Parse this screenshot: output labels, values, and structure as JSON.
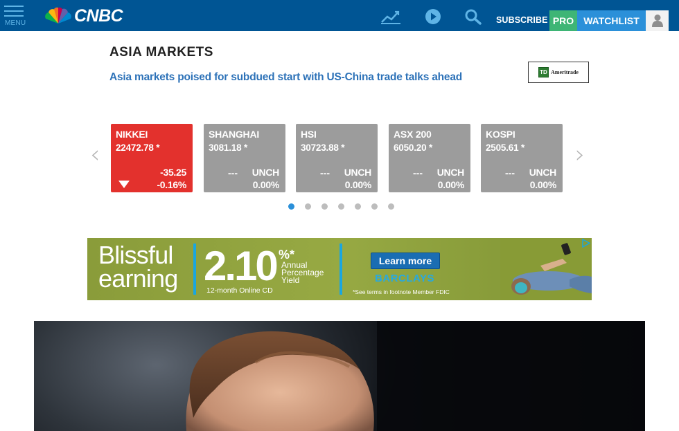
{
  "header": {
    "menu_label": "MENU",
    "brand": "CNBC",
    "subscribe_label": "SUBSCRIBE ›",
    "pro_label": "PRO",
    "watchlist_label": "WATCHLIST",
    "icons": [
      "menu-icon",
      "cnbc-peacock-logo",
      "chart-icon",
      "play-icon",
      "search-icon",
      "user-icon"
    ],
    "colors": {
      "bar": "#005594",
      "pro": "#3eb575",
      "watchlist": "#2b90d9"
    }
  },
  "markets": {
    "section_title": "ASIA MARKETS",
    "headline": "Asia markets poised for subdued start with US-China trade talks ahead",
    "sponsor": {
      "logo_mark": "TD",
      "name": "Ameritrade"
    },
    "cards": [
      {
        "name": "NIKKEI",
        "value": "22472.78 *",
        "change": "-35.25",
        "pct": "-0.16%",
        "state": "down",
        "color": "#e3312d"
      },
      {
        "name": "SHANGHAI",
        "value": "3081.18 *",
        "change": "UNCH",
        "pct": "0.00%",
        "dash": "---",
        "state": "unch",
        "color": "#9c9c9c"
      },
      {
        "name": "HSI",
        "value": "30723.88 *",
        "change": "UNCH",
        "pct": "0.00%",
        "dash": "---",
        "state": "unch",
        "color": "#9c9c9c"
      },
      {
        "name": "ASX 200",
        "value": "6050.20 *",
        "change": "UNCH",
        "pct": "0.00%",
        "dash": "---",
        "state": "unch",
        "color": "#9c9c9c"
      },
      {
        "name": "KOSPI",
        "value": "2505.61 *",
        "change": "UNCH",
        "pct": "0.00%",
        "dash": "---",
        "state": "unch",
        "color": "#9c9c9c"
      }
    ],
    "pagination": {
      "total": 7,
      "active": 1
    },
    "prev_arrow": "‹",
    "next_arrow": "›"
  },
  "ad": {
    "headline_line1": "Blissful",
    "headline_line2": "earning",
    "rate": "2.10",
    "rate_suffix": "%*",
    "rate_desc": "Annual Percentage Yield",
    "term": "12-month Online CD",
    "cta": "Learn more",
    "brand": "BARCLAYS",
    "terms": "*See terms in footnote   Member FDIC",
    "colors": {
      "background": "#8fa13c",
      "accent": "#1aa6e0",
      "cta": "#1a6db3"
    }
  }
}
